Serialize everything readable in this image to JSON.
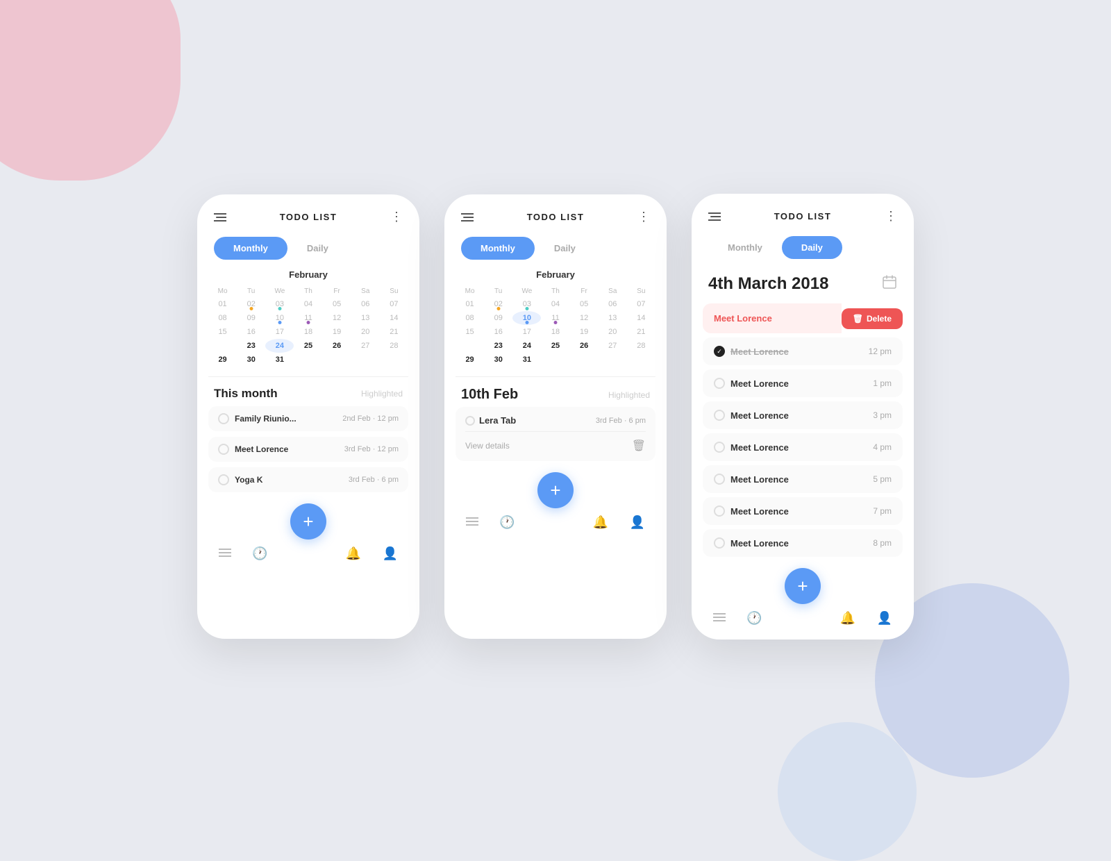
{
  "background": {
    "color": "#e8eaf0"
  },
  "screens": [
    {
      "id": "screen1",
      "header": {
        "title": "TODO LIST",
        "menu_icon": "≡",
        "more_icon": "⋮"
      },
      "toggle": {
        "monthly_label": "Monthly",
        "daily_label": "Daily",
        "active": "monthly"
      },
      "calendar": {
        "month": "February",
        "days_header": [
          "Mo",
          "Tu",
          "We",
          "Th",
          "Fr",
          "Sa",
          "Su"
        ],
        "weeks": [
          [
            "01",
            "02",
            "03",
            "04",
            "05",
            "06",
            "07"
          ],
          [
            "08",
            "09",
            "10",
            "11",
            "12",
            "13",
            "14"
          ],
          [
            "15",
            "16",
            "17",
            "18",
            "19",
            "20",
            "21"
          ],
          [
            "",
            "23",
            "24",
            "25",
            "26",
            "27",
            "28"
          ],
          [
            "29",
            "30",
            "31",
            "",
            "",
            "",
            ""
          ]
        ],
        "dots": {
          "02": "orange",
          "03": "teal",
          "10": "blue",
          "11": "purple"
        }
      },
      "section": {
        "label": "This month",
        "sub_label": "Highlighted"
      },
      "tasks": [
        {
          "name": "Family Riunio...",
          "date": "2nd Feb",
          "time": "12 pm"
        },
        {
          "name": "Meet Lorence",
          "date": "3rd Feb",
          "time": "12 pm"
        },
        {
          "name": "Yoga K",
          "date": "3rd Feb",
          "time": "6 pm"
        }
      ],
      "fab_icon": "+",
      "nav": [
        "list",
        "clock",
        "",
        "bell",
        "user"
      ]
    },
    {
      "id": "screen2",
      "header": {
        "title": "TODO LIST",
        "menu_icon": "≡",
        "more_icon": "⋮"
      },
      "toggle": {
        "monthly_label": "Monthly",
        "daily_label": "Daily",
        "active": "monthly"
      },
      "calendar": {
        "month": "February",
        "days_header": [
          "Mo",
          "Tu",
          "We",
          "Th",
          "Fr",
          "Sa",
          "Su"
        ],
        "weeks": [
          [
            "01",
            "02",
            "03",
            "04",
            "05",
            "06",
            "07"
          ],
          [
            "08",
            "09",
            "10",
            "11",
            "12",
            "13",
            "14"
          ],
          [
            "15",
            "16",
            "17",
            "18",
            "19",
            "20",
            "21"
          ],
          [
            "",
            "23",
            "24",
            "25",
            "26",
            "27",
            "28"
          ],
          [
            "29",
            "30",
            "31",
            "",
            "",
            "",
            ""
          ]
        ],
        "dots": {
          "02": "orange",
          "03": "teal",
          "10": "blue",
          "11": "purple"
        }
      },
      "event_date": "10th Feb",
      "highlighted_label": "Highlighted",
      "expanded_event": {
        "name": "Lera Tab",
        "date": "3rd Feb",
        "time": "6 pm",
        "view_details": "View details"
      },
      "fab_icon": "+",
      "nav": [
        "list",
        "clock",
        "",
        "bell",
        "user"
      ]
    },
    {
      "id": "screen3",
      "header": {
        "title": "TODO LIST",
        "menu_icon": "≡",
        "more_icon": "⋮"
      },
      "toggle": {
        "monthly_label": "Monthly",
        "daily_label": "Daily",
        "active": "daily"
      },
      "date_title": "4th March 2018",
      "delete_task": {
        "name": "Meet Lorence",
        "delete_label": "Delete"
      },
      "daily_tasks": [
        {
          "name": "Meet Lorence",
          "time": "12 pm",
          "checked": true
        },
        {
          "name": "Meet Lorence",
          "time": "1 pm"
        },
        {
          "name": "Meet Lorence",
          "time": "3 pm"
        },
        {
          "name": "Meet Lorence",
          "time": "4 pm"
        },
        {
          "name": "Meet Lorence",
          "time": "5 pm"
        },
        {
          "name": "Meet Lorence",
          "time": "7 pm"
        },
        {
          "name": "Meet Lorence",
          "time": "8 pm"
        }
      ],
      "fab_icon": "+",
      "nav": [
        "list",
        "clock",
        "",
        "bell",
        "user"
      ]
    }
  ]
}
